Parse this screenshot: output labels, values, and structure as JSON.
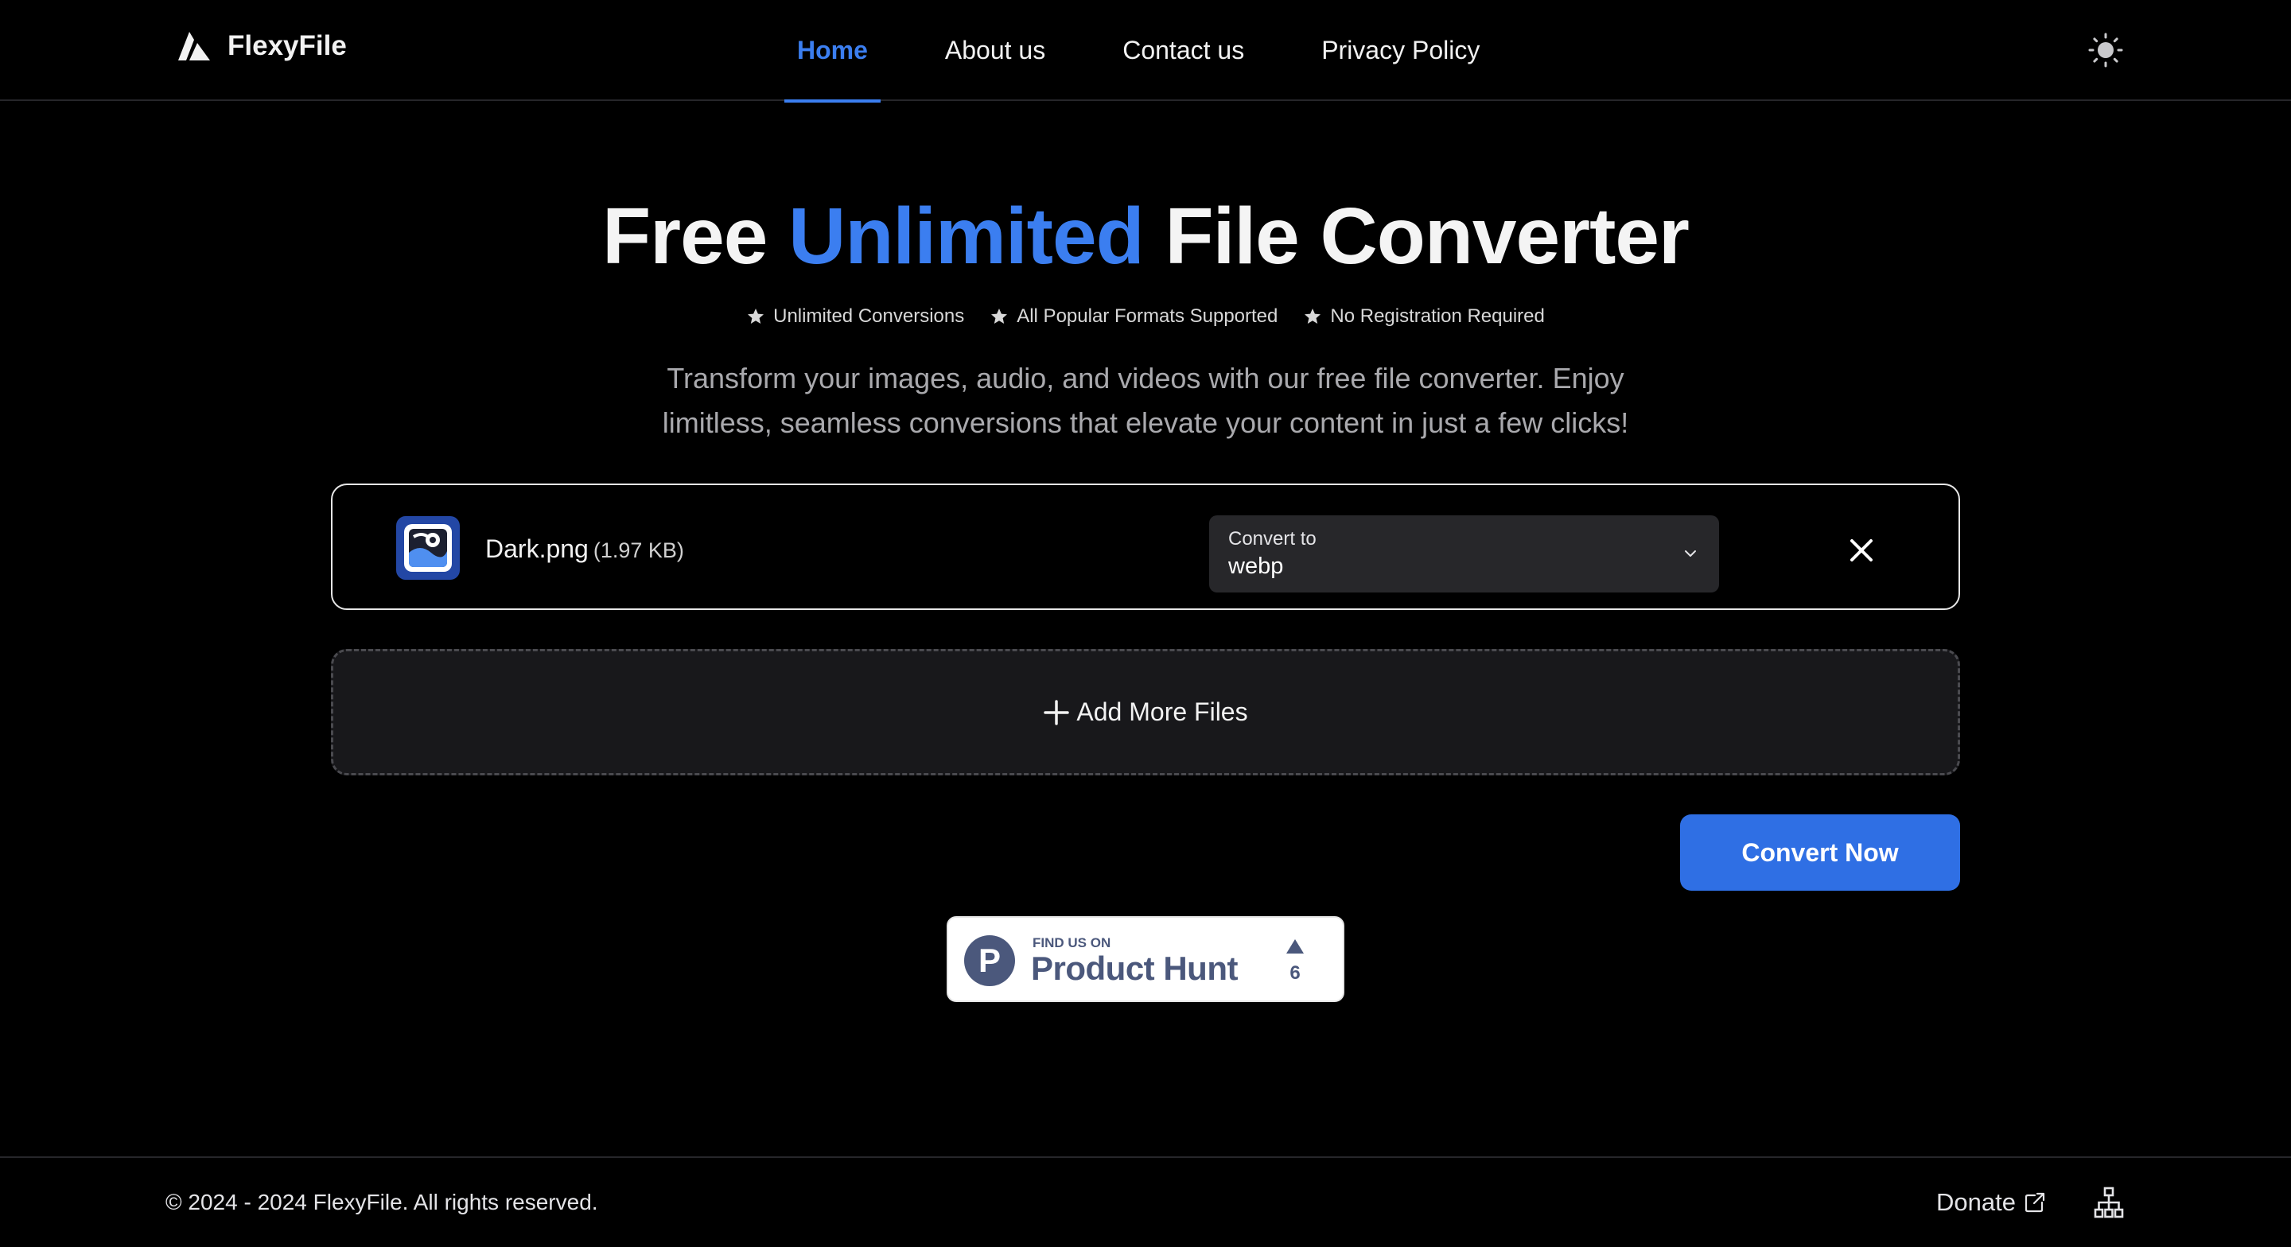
{
  "brand": {
    "name": "FlexyFile"
  },
  "nav": {
    "items": [
      {
        "label": "Home",
        "active": true
      },
      {
        "label": "About us",
        "active": false
      },
      {
        "label": "Contact us",
        "active": false
      },
      {
        "label": "Privacy Policy",
        "active": false
      }
    ],
    "theme_toggle_icon": "sun-icon"
  },
  "hero": {
    "title_prefix": "Free",
    "title_accent": "Unlimited",
    "title_suffix": "File Converter",
    "features": [
      "Unlimited Conversions",
      "All Popular Formats Supported",
      "No Registration Required"
    ],
    "subtitle_line1": "Transform your images, audio, and videos with our free file converter. Enjoy",
    "subtitle_line2": "limitless, seamless conversions that elevate your content in just a few clicks!"
  },
  "file": {
    "name": "Dark.png",
    "size": "(1.97 KB)",
    "convert_label": "Convert to",
    "convert_value": "webp"
  },
  "add_more": {
    "label": "Add More Files"
  },
  "convert_button": {
    "label": "Convert Now"
  },
  "product_hunt": {
    "find_text": "FIND US ON",
    "name": "Product Hunt",
    "logo_letter": "P",
    "upvotes": "6"
  },
  "footer": {
    "copyright": "© 2024 - 2024 FlexyFile. All rights reserved.",
    "donate_label": "Donate"
  },
  "colors": {
    "accent": "#3b7ef0",
    "button": "#2f6fe4",
    "background": "#000000",
    "product_hunt": "#4b587c"
  }
}
